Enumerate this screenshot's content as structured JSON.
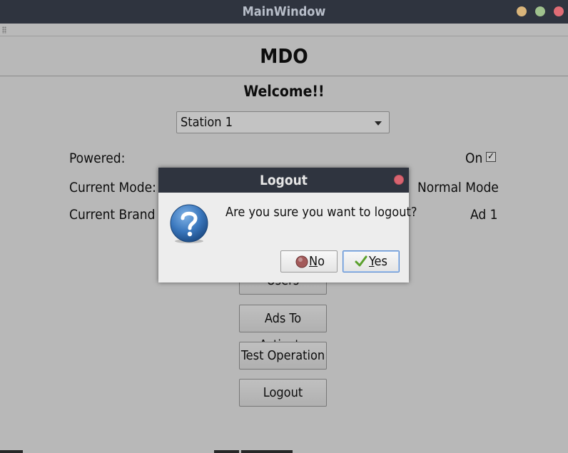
{
  "window": {
    "title": "MainWindow"
  },
  "header": {
    "title": "MDO"
  },
  "welcome": "Welcome!!",
  "station_select": {
    "value": "Station 1"
  },
  "status": {
    "powered_label": "Powered:",
    "powered_value": "On",
    "powered_checked": true,
    "mode_label": "Current Mode:",
    "mode_value": "Normal Mode",
    "brand_label": "Current Brand A",
    "brand_value": "Ad 1"
  },
  "buttons": {
    "users": "Users",
    "ads_to_activate": "Ads To Activate",
    "test_operation": "Test Operation",
    "logout": "Logout"
  },
  "dialog": {
    "title": "Logout",
    "message": "Are you sure you want to logout?",
    "no_mnemonic": "N",
    "no_rest": "o",
    "yes_mnemonic": "Y",
    "yes_rest": "es"
  },
  "icons": {
    "question": "question-icon",
    "no": "no-icon",
    "yes": "checkmark-icon"
  },
  "colors": {
    "titlebar": "#2f343f",
    "accent": "#5b8ccf"
  }
}
